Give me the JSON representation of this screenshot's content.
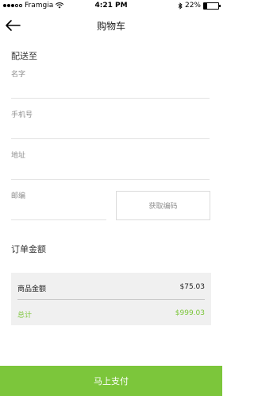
{
  "status_bar": {
    "carrier": "Framgia",
    "time": "4:21 PM",
    "battery": "22%",
    "battery_level": 0.22
  },
  "nav": {
    "title": "购物车"
  },
  "shipping": {
    "section_title": "配送至",
    "name_label": "名字",
    "phone_label": "手机号",
    "address_label": "地址",
    "zip_label": "邮编",
    "get_code_label": "获取编码"
  },
  "order": {
    "section_title": "订单金额",
    "subtotal_label": "商品金额",
    "subtotal_value": "$75.03",
    "total_label": "总计",
    "total_value": "$999.03"
  },
  "pay_button": "马上支付",
  "colors": {
    "accent": "#7cc63b"
  }
}
